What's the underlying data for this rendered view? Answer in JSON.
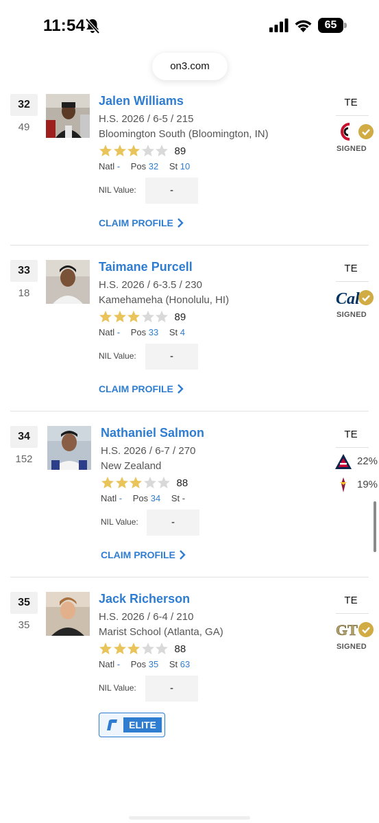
{
  "status_bar": {
    "time": "11:54",
    "battery": "65"
  },
  "browser": {
    "url": "on3.com"
  },
  "players": [
    {
      "rank": "32",
      "sub_rank": "49",
      "name": "Jalen Williams",
      "line1": "H.S. 2026 / 6-5 / 215",
      "line2": "Bloomington South (Bloomington, IN)",
      "stars": 3,
      "rating": "89",
      "natl_label": "Natl",
      "natl": "-",
      "pos_label": "Pos",
      "pos_rank": "32",
      "st_label": "St",
      "st": "10",
      "nil_label": "NIL Value:",
      "nil_value": "-",
      "claim_label": "CLAIM PROFILE",
      "position": "TE",
      "status": "SIGNED",
      "school_logo": "cincinnati-logo"
    },
    {
      "rank": "33",
      "sub_rank": "18",
      "name": "Taimane Purcell",
      "line1": "H.S. 2026 / 6-3.5 / 230",
      "line2": "Kamehameha (Honolulu, HI)",
      "stars": 3,
      "rating": "89",
      "natl_label": "Natl",
      "natl": "-",
      "pos_label": "Pos",
      "pos_rank": "33",
      "st_label": "St",
      "st": "4",
      "nil_label": "NIL Value:",
      "nil_value": "-",
      "claim_label": "CLAIM PROFILE",
      "position": "TE",
      "status": "SIGNED",
      "school_logo": "cal-logo"
    },
    {
      "rank": "34",
      "sub_rank": "152",
      "name": "Nathaniel Salmon",
      "line1": "H.S. 2026 / 6-7 / 270",
      "line2": "New Zealand",
      "stars": 3,
      "rating": "88",
      "natl_label": "Natl",
      "natl": "-",
      "pos_label": "Pos",
      "pos_rank": "34",
      "st_label": "St",
      "st": "-",
      "nil_label": "NIL Value:",
      "nil_value": "-",
      "claim_label": "CLAIM PROFILE",
      "position": "TE",
      "predictions": [
        {
          "school_logo": "arizona-logo",
          "pct": "22%"
        },
        {
          "school_logo": "arizona-state-logo",
          "pct": "19%"
        }
      ]
    },
    {
      "rank": "35",
      "sub_rank": "35",
      "name": "Jack Richerson",
      "line1": "H.S. 2026 / 6-4 / 210",
      "line2": "Marist School (Atlanta, GA)",
      "stars": 3,
      "rating": "88",
      "natl_label": "Natl",
      "natl": "-",
      "pos_label": "Pos",
      "pos_rank": "35",
      "st_label": "St",
      "st": "63",
      "nil_label": "NIL Value:",
      "nil_value": "-",
      "badge_label": "ELITE",
      "position": "TE",
      "status": "SIGNED",
      "school_logo": "georgia-tech-logo"
    }
  ],
  "colors": {
    "accent": "#2f7dd1",
    "star_filled": "#e9c45a",
    "star_empty": "#d9d9d9",
    "signed_check": "#d1ab44"
  }
}
